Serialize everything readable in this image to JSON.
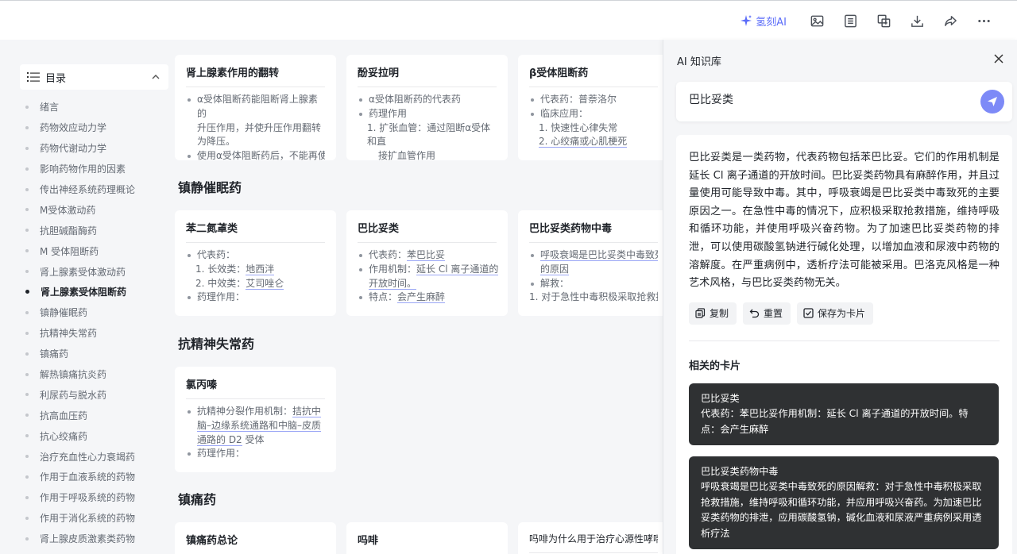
{
  "topbar": {
    "ai_label": "氢刻AI",
    "tools": [
      "image-icon",
      "list-icon",
      "copy-add-icon",
      "download-icon",
      "share-icon",
      "more-icon"
    ]
  },
  "toc": {
    "title": "目录",
    "items": [
      "绪言",
      "药物效应动力学",
      "药物代谢动力学",
      "影响药物作用的因素",
      "传出神经系统药理概论",
      "M受体激动药",
      "抗胆碱酯酶药",
      "M 受体阻断药",
      "肾上腺素受体激动药",
      "肾上腺素受体阻断药",
      "镇静催眠药",
      "抗精神失常药",
      "镇痛药",
      "解热镇痛抗炎药",
      "利尿药与脱水药",
      "抗高血压药",
      "抗心绞痛药",
      "治疗充血性心力衰竭药",
      "作用于血液系统的药物",
      "作用于呼吸系统的药物",
      "作用于消化系统的药物",
      "肾上腺皮质激素类药物"
    ],
    "active_index": 9
  },
  "main": {
    "row1": [
      {
        "title": "肾上腺素作用的翻转",
        "lines": [
          "α受体阻断药能阻断肾上腺素的",
          "升压作用，并使升压作用翻转",
          "为降压。",
          "使用α受体阻断药后，不能再使"
        ]
      },
      {
        "title": "酚妥拉明",
        "lines": [
          "α受体阻断药的代表药",
          "药理作用",
          "1. 扩张血管：通过阻断α受体和直",
          "接扩血管作用"
        ]
      },
      {
        "title": "β受体阻断药",
        "lines": [
          "代表药：普萘洛尔",
          "临床应用：",
          "1. 快速性心律失常",
          "2. 心绞痛或心肌梗死"
        ]
      }
    ],
    "section_sedative": "镇静催眠药",
    "row2": [
      {
        "title": "苯二氮䓬类",
        "lines": [
          "代表药：",
          "1. 长效类：",
          "地西泮",
          "2. 中效类：",
          "艾司唑仑",
          "药理作用："
        ]
      },
      {
        "title": "巴比妥类",
        "lines": [
          "代表药：",
          "苯巴比妥",
          "作用机制：",
          "延长 Cl 离子通道的",
          "开放时间。",
          "特点：",
          "会产生麻醉"
        ]
      },
      {
        "title": "巴比妥类药物中毒",
        "lines": [
          "呼吸衰竭是巴比妥类中毒致死",
          "的原因",
          "解救：",
          "1. 对于急性中毒积极采取抢救措"
        ]
      }
    ],
    "section_antipsychotic": "抗精神失常药",
    "row3": [
      {
        "title": "氯丙嗪",
        "lines": [
          "抗精神分裂作用机制：",
          "拮抗中",
          "脑–边缘系统通路和中脑–皮质",
          "通路的 D2",
          " 受体",
          "药理作用："
        ]
      }
    ],
    "section_analgesic": "镇痛药",
    "row4": [
      {
        "title": "镇痛药总论"
      },
      {
        "title": "吗啡"
      },
      {
        "title": "吗啡为什么用于治疗心源性哮喘?"
      }
    ]
  },
  "panel": {
    "title": "AI 知识库",
    "query": "巴比妥类",
    "answer": "巴比妥类是一类药物，代表药物包括苯巴比妥。它们的作用机制是延长 Cl 离子通道的开放时间。巴比妥类药物具有麻醉作用，并且过量使用可能导致中毒。其中，呼吸衰竭是巴比妥类中毒致死的主要原因之一。在急性中毒的情况下，应积极采取抢救措施，维持呼吸和循环功能，并使用呼吸兴奋药物。为了加速巴比妥类药物的排泄，可以使用碳酸氢钠进行碱化处理，以增加血液和尿液中药物的溶解度。在严重病例中，透析疗法可能被采用。巴洛克风格是一种艺术风格，与巴比妥类药物无关。",
    "actions": {
      "copy": "复制",
      "reset": "重置",
      "save": "保存为卡片"
    },
    "related_title": "相关的卡片",
    "related": [
      {
        "title": "巴比妥类",
        "body": "代表药：苯巴比妥作用机制：延长 Cl 离子通道的开放时间。特点：会产生麻醉"
      },
      {
        "title": "巴比妥类药物中毒",
        "body": "呼吸衰竭是巴比妥类中毒致死的原因解救：对于急性中毒积极采取抢救措施，维持呼吸和循环功能，并应用呼吸兴奋药。为加速巴比妥类药物的排泄，应用碳酸氢钠，碱化血液和尿液严重病例采用透析疗法"
      }
    ]
  }
}
